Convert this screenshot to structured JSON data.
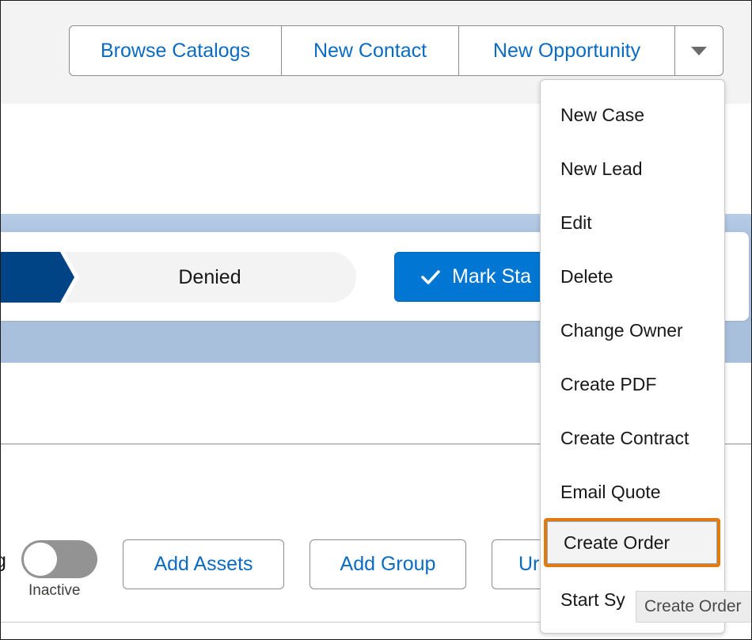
{
  "header": {
    "buttons": [
      {
        "label": "Browse Catalogs"
      },
      {
        "label": "New Contact"
      },
      {
        "label": "New Opportunity"
      }
    ],
    "more_icon": "chevron-down-icon"
  },
  "path": {
    "stage_label": "Denied",
    "mark_button_label": "Mark Sta",
    "mark_icon": "checkmark-icon",
    "colors": {
      "active_stage": "#014486",
      "button": "#0176d3"
    }
  },
  "toolbar": {
    "cut_label": "g",
    "toggle_state": "Inactive",
    "buttons": [
      {
        "label": "Add Assets"
      },
      {
        "label": "Add Group"
      },
      {
        "label": "Ur"
      }
    ]
  },
  "menu": {
    "items": [
      {
        "label": "New Case"
      },
      {
        "label": "New Lead"
      },
      {
        "label": "Edit"
      },
      {
        "label": "Delete"
      },
      {
        "label": "Change Owner"
      },
      {
        "label": "Create PDF"
      },
      {
        "label": "Create Contract"
      },
      {
        "label": "Email Quote"
      },
      {
        "label": "Create Order"
      },
      {
        "label": "Start Sy"
      }
    ],
    "highlight_color": "#e07b0f"
  },
  "tooltip": {
    "text": "Create Order"
  }
}
